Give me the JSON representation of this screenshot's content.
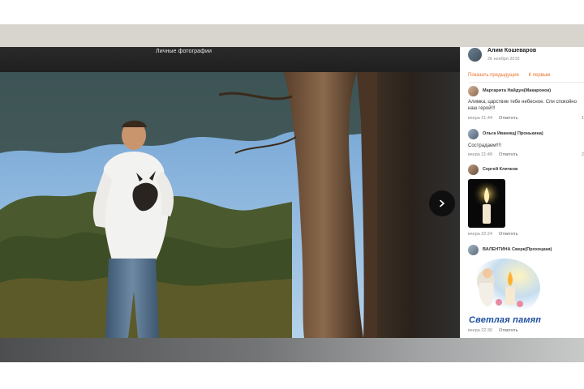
{
  "album": {
    "title": "Личные фотографии"
  },
  "author": {
    "name": "Алим Кошеваров",
    "date": "26 ноября 2015"
  },
  "nav": {
    "show_previous": "Показать предыдущие",
    "to_first": "К первым"
  },
  "comments": [
    {
      "name": "Маргарита Найдун(Макаронок)",
      "text_line1": "Алимка, царствие тебе небесное. Спи спокойно",
      "text_line2": "наш герой!!!",
      "time": "вчера 21:44",
      "reply": "Ответить",
      "count": "1"
    },
    {
      "name": "Ольга Иванищ( Пронькина)",
      "text_line1": "Сострадаем!!!!",
      "time": "вчера 21:49",
      "reply": "Ответить",
      "count": "2"
    },
    {
      "name": "Сергей Клячков",
      "time": "вчера 22:24",
      "reply": "Ответить"
    },
    {
      "name": "ВАЛЕНТИНА Сверк(Прохоцкая)",
      "image_text": "Светлая память...",
      "time": "вчера 22:30",
      "reply": "Ответить"
    }
  ],
  "icons": {
    "next": "chevron-right-icon"
  },
  "colors": {
    "accent": "#eb722e",
    "viewer_bg": "#1d1d1d"
  }
}
